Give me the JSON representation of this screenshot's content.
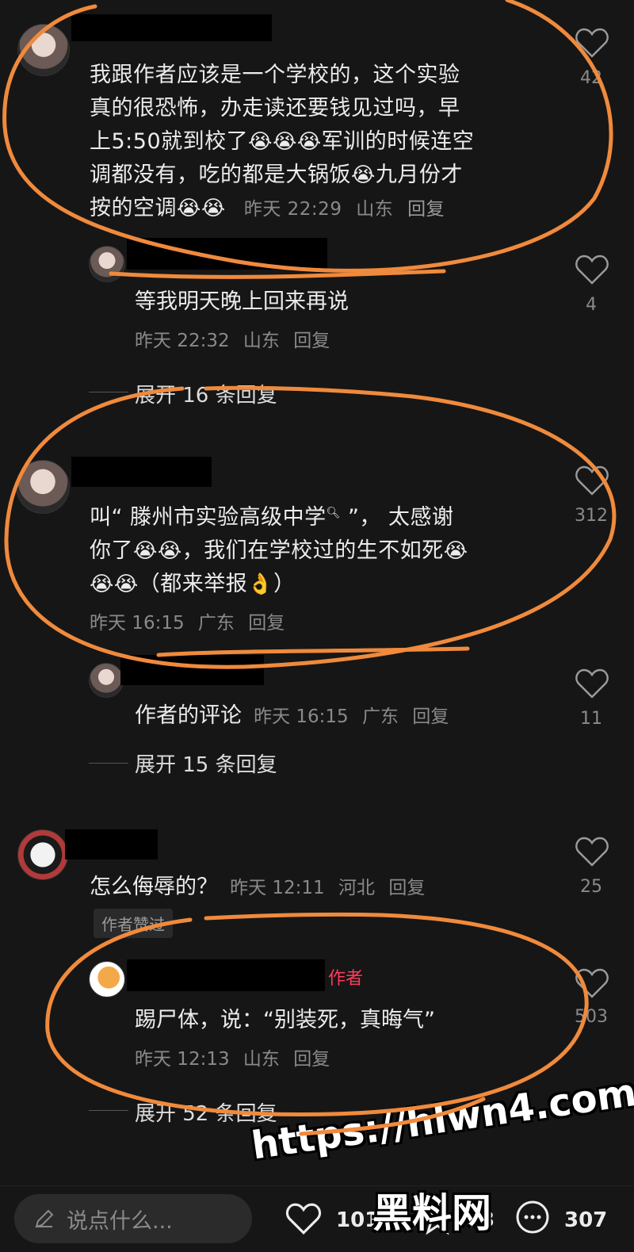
{
  "comments": [
    {
      "text_lines": [
        "我跟作者应该是一个学校的，这个实验",
        "真的很恐怖，办走读还要钱见过吗，早",
        "上5:50就到校了",
        "军训的时候连空",
        "调都没有，吃的都是大锅饭",
        "九月份才",
        "按的空调"
      ],
      "time": "昨天 22:29",
      "region": "山东",
      "reply": "回复",
      "likes": "42"
    },
    {
      "text": "等我明天晚上回来再说",
      "time": "昨天 22:32",
      "region": "山东",
      "reply": "回复",
      "likes": "4"
    },
    {
      "text_lines": [
        "叫“ 滕州市实验高级中学",
        " ”， 太感谢",
        "你了",
        "，我们在学校过的生不如死",
        "（都来举报",
        "）"
      ],
      "time": "昨天 16:15",
      "region": "广东",
      "reply": "回复",
      "likes": "312"
    },
    {
      "text": "作者的评论",
      "time": "昨天 16:15",
      "region": "广东",
      "reply": "回复",
      "likes": "11"
    },
    {
      "text": "怎么侮辱的？",
      "time": "昨天 12:11",
      "region": "河北",
      "reply": "回复",
      "likes": "25",
      "badge": "作者赞过"
    },
    {
      "author_tag": "作者",
      "text": "踢尸体，说：“别装死，真晦气”",
      "time": "昨天 12:13",
      "region": "山东",
      "reply": "回复",
      "likes": "503"
    }
  ],
  "expand": [
    "展开 16 条回复",
    "展开 15 条回复",
    "展开 52 条回复"
  ],
  "bottom": {
    "input_placeholder": "说点什么...",
    "likes": "1015",
    "stars": "93",
    "comments": "307"
  },
  "watermark": {
    "url": "https://hlwn4.com",
    "text": "黑料网"
  },
  "icons": {
    "heart": "heart-outline-icon",
    "edit": "pencil-icon",
    "star": "star-icon",
    "comment": "comment-bubble-icon"
  },
  "colors": {
    "background": "#161616",
    "annotation": "#f08a3c",
    "author_tag": "#ff3b5c"
  }
}
